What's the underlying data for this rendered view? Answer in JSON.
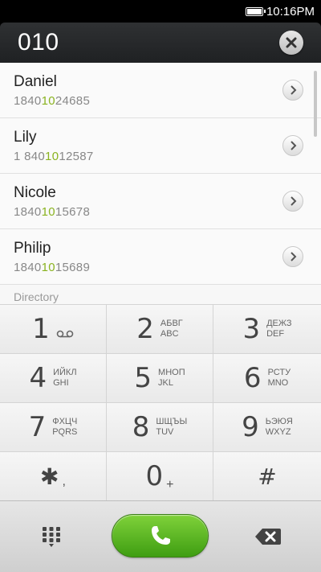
{
  "status_bar": {
    "time": "10:16PM"
  },
  "search": {
    "query": "010"
  },
  "contacts": [
    {
      "name": "Daniel",
      "number_pre": "1840",
      "number_match": "10",
      "number_post": "24685"
    },
    {
      "name": "Lily",
      "number_pre": "1 840",
      "number_match": "10",
      "number_post": "12587"
    },
    {
      "name": "Nicole",
      "number_pre": "1840",
      "number_match": "10",
      "number_post": "15678"
    },
    {
      "name": "Philip",
      "number_pre": "1840",
      "number_match": "10",
      "number_post": "15689"
    }
  ],
  "section_label": "Directory",
  "keys": [
    {
      "digit": "1",
      "l1": "",
      "l2": "",
      "sub": "voicemail"
    },
    {
      "digit": "2",
      "l1": "АБВГ",
      "l2": "ABC"
    },
    {
      "digit": "3",
      "l1": "ДЕЖЗ",
      "l2": "DEF"
    },
    {
      "digit": "4",
      "l1": "ИЙКЛ",
      "l2": "GHI"
    },
    {
      "digit": "5",
      "l1": "МНОП",
      "l2": "JKL"
    },
    {
      "digit": "6",
      "l1": "РСТУ",
      "l2": "MNO"
    },
    {
      "digit": "7",
      "l1": "ФХЦЧ",
      "l2": "PQRS"
    },
    {
      "digit": "8",
      "l1": "ШЩЪЫ",
      "l2": "TUV"
    },
    {
      "digit": "9",
      "l1": "ЬЭЮЯ",
      "l2": "WXYZ"
    },
    {
      "digit": "✱",
      "sub": ","
    },
    {
      "digit": "0",
      "sub": "+"
    },
    {
      "digit": "#"
    }
  ],
  "colors": {
    "highlight": "#8ab320",
    "call_green": "#4caf1e"
  }
}
